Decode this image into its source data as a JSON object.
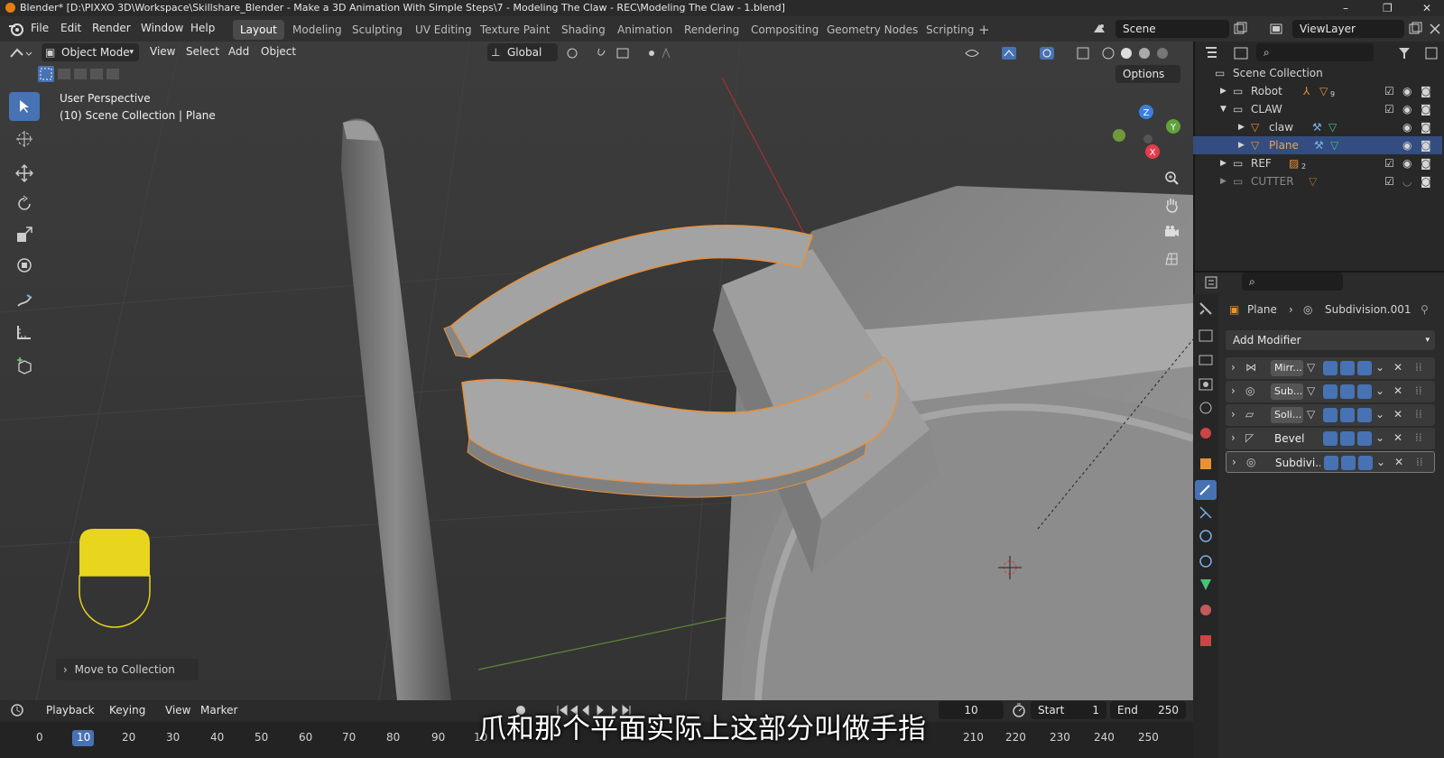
{
  "title_bar": {
    "text": "Blender* [D:\\PIXXO 3D\\Workspace\\Skillshare_Blender - Make a 3D Animation With Simple Steps\\7 - Modeling The Claw - REC\\Modeling The Claw - 1.blend]",
    "min": "–",
    "max": "❐",
    "close": "✕"
  },
  "menu": [
    "File",
    "Edit",
    "Render",
    "Window",
    "Help"
  ],
  "workspaces": [
    "Layout",
    "Modeling",
    "Sculpting",
    "UV Editing",
    "Texture Paint",
    "Shading",
    "Animation",
    "Rendering",
    "Compositing",
    "Geometry Nodes",
    "Scripting"
  ],
  "active_workspace": "Layout",
  "add_workspace": "+",
  "scene": "Scene",
  "view_layer": "ViewLayer",
  "viewport_header": {
    "mode": "Object Mode",
    "menus": [
      "View",
      "Select",
      "Add",
      "Object"
    ],
    "transform_orientation": "Global",
    "options": "Options"
  },
  "viewport_info": {
    "perspective": "User Perspective",
    "collection": "(10) Scene Collection | Plane"
  },
  "gizmo": {
    "x": "X",
    "y": "Y",
    "z": "Z"
  },
  "last_operator": "Move to Collection",
  "outliner": {
    "root": "Scene Collection",
    "items": [
      {
        "label": "Robot",
        "badge": "9",
        "dim": false
      },
      {
        "label": "CLAW",
        "badge": "",
        "dim": false
      },
      {
        "label": "claw",
        "badge": "",
        "dim": false
      },
      {
        "label": "Plane",
        "badge": "",
        "dim": false
      },
      {
        "label": "REF",
        "badge": "2",
        "dim": false
      },
      {
        "label": "CUTTER",
        "badge": "",
        "dim": true
      }
    ]
  },
  "properties": {
    "breadcrumb_object": "Plane",
    "breadcrumb_modifier": "Subdivision.001",
    "add_modifier": "Add Modifier",
    "modifiers": [
      "Mirr...",
      "Sub...",
      "Soli...",
      "Bevel",
      "Subdivi..."
    ]
  },
  "timeline": {
    "menus": [
      "Playback",
      "Keying",
      "View",
      "Marker"
    ],
    "current_frame": "10",
    "start_label": "Start",
    "start": "1",
    "end_label": "End",
    "end": "250",
    "ticks": [
      "0",
      "10",
      "20",
      "30",
      "40",
      "50",
      "60",
      "70",
      "80",
      "90",
      "10",
      "210",
      "220",
      "230",
      "240",
      "250"
    ]
  },
  "subtitle": "爪和那个平面实际上这部分叫做手指",
  "colors": {
    "accent": "#4772b3",
    "selection_outline": "#e8913a",
    "overlay_yellow": "#e8d51e"
  }
}
